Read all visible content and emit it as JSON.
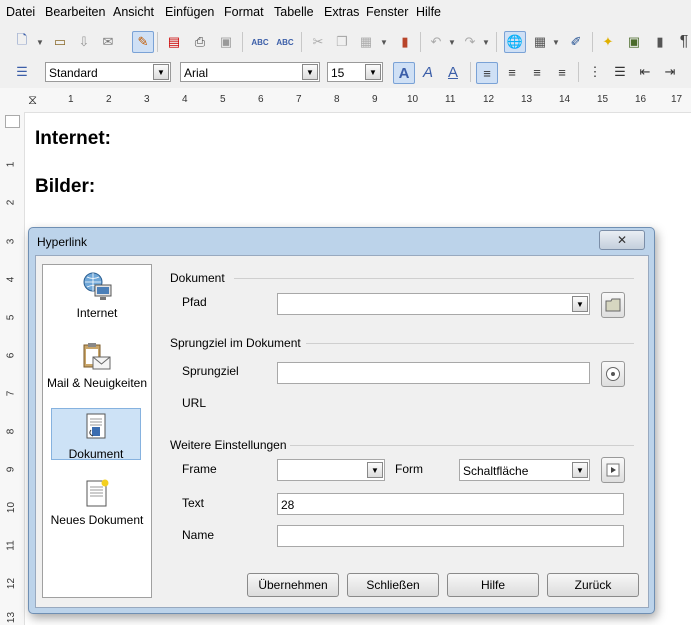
{
  "menu": {
    "items": [
      "Datei",
      "Bearbeiten",
      "Ansicht",
      "Einfügen",
      "Format",
      "Tabelle",
      "Extras",
      "Fenster",
      "Hilfe"
    ]
  },
  "toolbar": {
    "paragraph_style": "Standard",
    "font_name": "Arial",
    "font_size": "15"
  },
  "ruler": {
    "h_numbers": [
      "1",
      "2",
      "3",
      "4",
      "5",
      "6",
      "7",
      "8",
      "9",
      "10",
      "11",
      "12",
      "13",
      "14",
      "15",
      "16",
      "17"
    ],
    "v_numbers": [
      "1",
      "2",
      "3",
      "4",
      "5",
      "6",
      "7",
      "8",
      "9",
      "10",
      "11",
      "12",
      "13"
    ]
  },
  "document": {
    "headings": [
      "Internet:",
      "Bilder:"
    ]
  },
  "dialog": {
    "title": "Hyperlink",
    "close_glyph": "✕",
    "sidebar": [
      {
        "label": "Internet",
        "icon": "globe-computer-icon"
      },
      {
        "label": "Mail & Neuigkeiten",
        "icon": "mail-clipboard-icon"
      },
      {
        "label": "Dokument",
        "icon": "document-link-icon",
        "selected": true
      },
      {
        "label": "Neues Dokument",
        "icon": "new-document-icon"
      }
    ],
    "section_document": "Dokument",
    "path_label": "Pfad",
    "path_value": "",
    "section_target": "Sprungziel im Dokument",
    "target_label": "Sprungziel",
    "target_value": "",
    "url_label": "URL",
    "section_further": "Weitere Einstellungen",
    "frame_label": "Frame",
    "frame_value": "",
    "form_label": "Form",
    "form_value": "Schaltfläche",
    "text_label": "Text",
    "text_value": "28",
    "name_label": "Name",
    "name_value": "",
    "buttons": {
      "apply": "Übernehmen",
      "close": "Schließen",
      "help": "Hilfe",
      "back": "Zurück"
    }
  },
  "colors": {
    "dialog_frame": "#bcd3ea",
    "selection": "#cde2f6"
  }
}
